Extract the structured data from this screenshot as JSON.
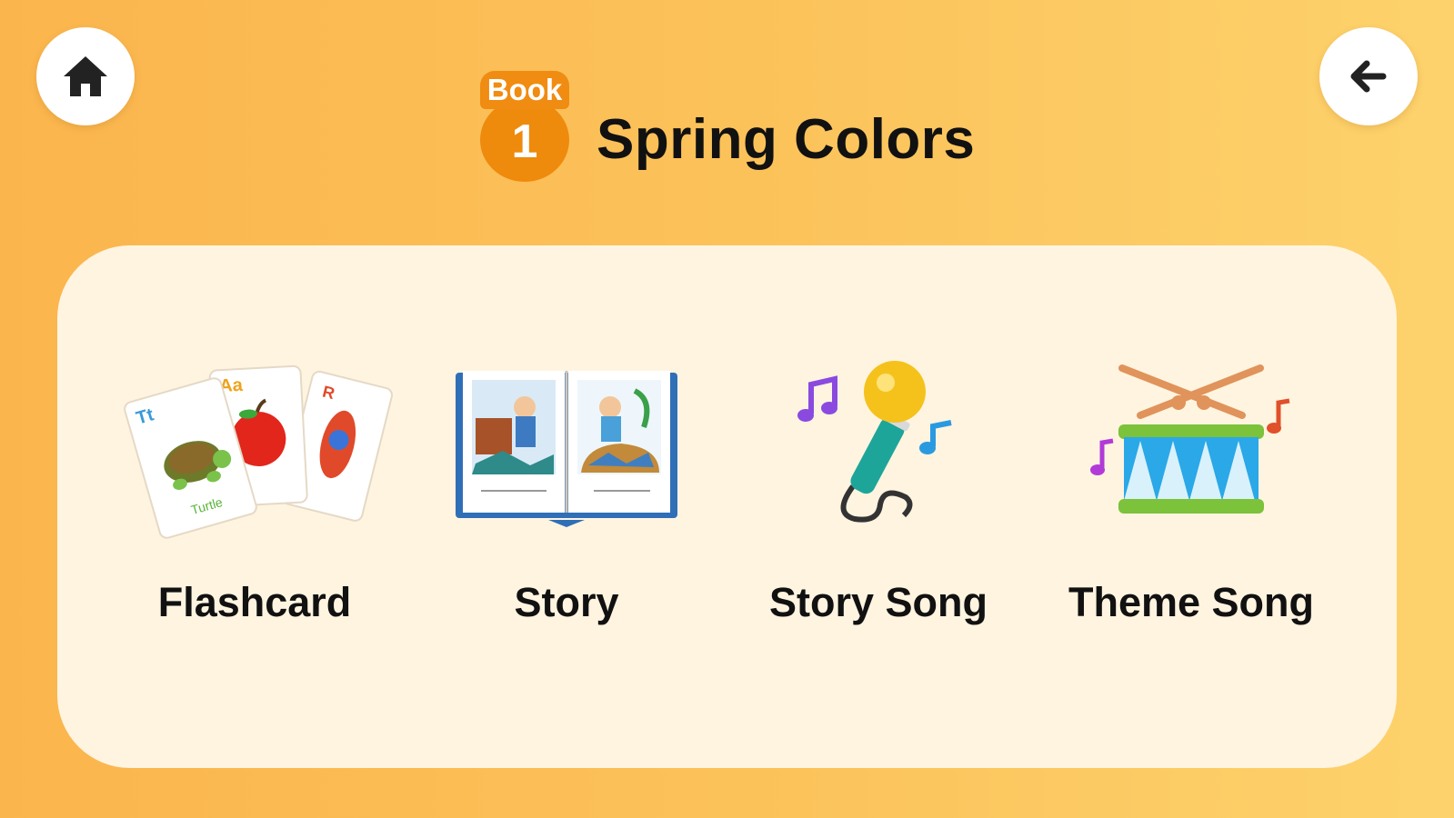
{
  "header": {
    "book_word": "Book",
    "book_number": "1",
    "title": "Spring Colors"
  },
  "nav": {
    "home_icon": "home-icon",
    "back_icon": "arrow-left-icon"
  },
  "menu": {
    "items": [
      {
        "label": "Flashcard",
        "icon": "flashcards-icon"
      },
      {
        "label": "Story",
        "icon": "open-book-icon"
      },
      {
        "label": "Story Song",
        "icon": "microphone-icon"
      },
      {
        "label": "Theme Song",
        "icon": "drum-icon"
      }
    ]
  },
  "colors": {
    "background": "#fcc35b",
    "panel": "#fff4e0",
    "badge": "#ee8a0c"
  }
}
